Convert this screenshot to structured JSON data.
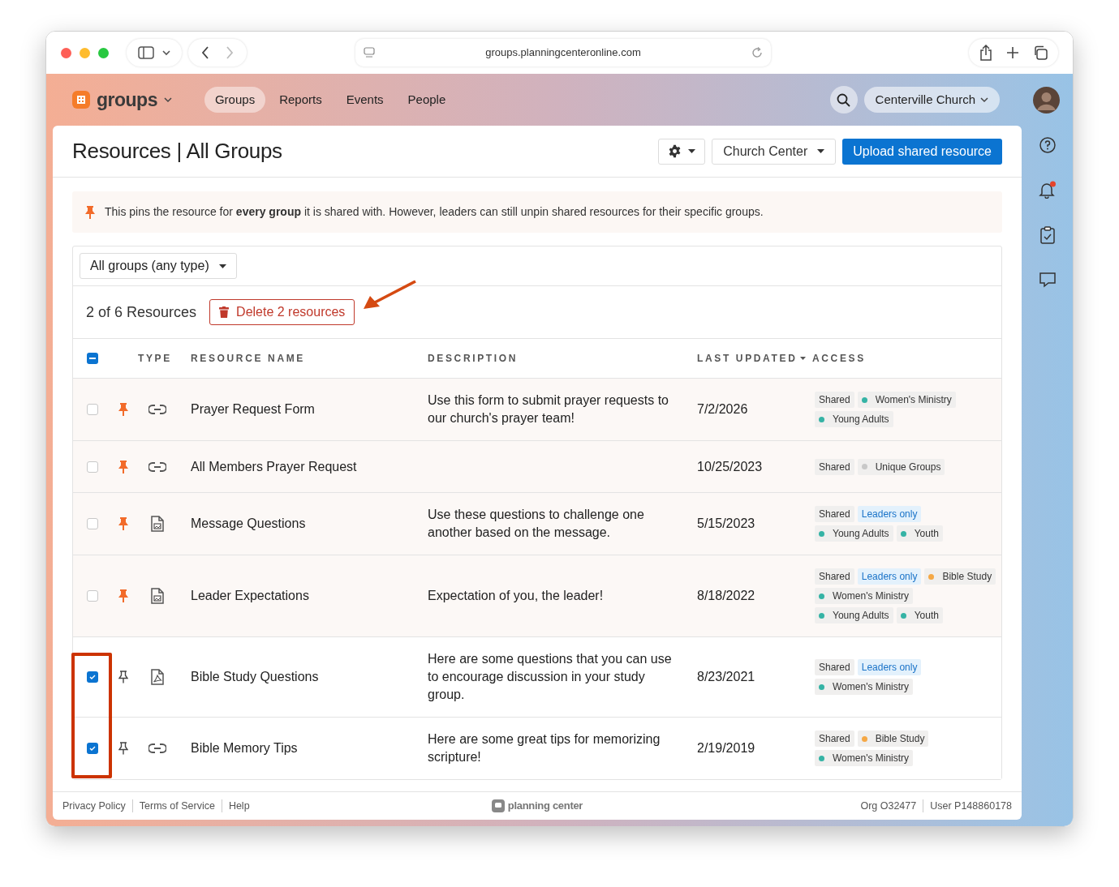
{
  "browser": {
    "url": "groups.planningcenteronline.com"
  },
  "app": {
    "name": "groups",
    "nav": [
      {
        "label": "Groups",
        "selected": true
      },
      {
        "label": "Reports",
        "selected": false
      },
      {
        "label": "Events",
        "selected": false
      },
      {
        "label": "People",
        "selected": false
      }
    ],
    "organization": "Centerville Church"
  },
  "page": {
    "title": "Resources | All Groups",
    "church_center_button": "Church Center",
    "upload_button": "Upload shared resource"
  },
  "notice": "This pins the resource for **every group** it is shared with. However, leaders can still unpin shared resources for their specific groups.",
  "filter": {
    "value": "All groups (any type)"
  },
  "summary": {
    "count": "2 of 6 Resources",
    "delete_button": "Delete 2 resources"
  },
  "table": {
    "select_all_indeterminate": true,
    "columns": [
      {
        "label": "TYPE",
        "sorted": false
      },
      {
        "label": "RESOURCE NAME",
        "sorted": false
      },
      {
        "label": "DESCRIPTION",
        "sorted": false
      },
      {
        "label": "LAST UPDATED",
        "sorted": true
      },
      {
        "label": "ACCESS",
        "sorted": false
      }
    ],
    "rows": [
      {
        "checked": false,
        "pinned": true,
        "kind": "link",
        "name": "Prayer Request Form",
        "description": "Use this form to submit prayer requests to our church's prayer team!",
        "last_updated": "7/2/2026",
        "access": [
          [
            {
              "kind": "shared",
              "label": "Shared"
            },
            {
              "kind": "group",
              "label": "Women's Ministry",
              "color": "#35b3a5"
            }
          ],
          [
            {
              "kind": "group",
              "label": "Young Adults",
              "color": "#35b3a5"
            }
          ]
        ]
      },
      {
        "checked": false,
        "pinned": true,
        "kind": "link",
        "name": "All Members Prayer Request",
        "last_updated": "10/25/2023",
        "access": [
          [
            {
              "kind": "shared",
              "label": "Shared"
            },
            {
              "kind": "group",
              "label": "Unique Groups",
              "color": "#c8c8c8"
            }
          ]
        ]
      },
      {
        "checked": false,
        "pinned": true,
        "kind": "image",
        "name": "Message Questions",
        "description": "Use these questions to challenge one another based on the message.",
        "last_updated": "5/15/2023",
        "access": [
          [
            {
              "kind": "shared",
              "label": "Shared"
            },
            {
              "kind": "leaders",
              "label": "Leaders only"
            }
          ],
          [
            {
              "kind": "group",
              "label": "Young Adults",
              "color": "#35b3a5"
            },
            {
              "kind": "group",
              "label": "Youth",
              "color": "#35b3a5"
            }
          ]
        ]
      },
      {
        "checked": false,
        "pinned": true,
        "kind": "image",
        "name": "Leader Expectations",
        "description": "Expectation of you, the leader!",
        "last_updated": "8/18/2022",
        "access": [
          [
            {
              "kind": "shared",
              "label": "Shared"
            },
            {
              "kind": "leaders",
              "label": "Leaders only"
            },
            {
              "kind": "group",
              "label": "Bible Study",
              "color": "#f5a846"
            }
          ],
          [
            {
              "kind": "group",
              "label": "Women's Ministry",
              "color": "#35b3a5"
            }
          ],
          [
            {
              "kind": "group",
              "label": "Young Adults",
              "color": "#35b3a5"
            },
            {
              "kind": "group",
              "label": "Youth",
              "color": "#35b3a5"
            }
          ]
        ]
      },
      {
        "checked": true,
        "pinned": false,
        "kind": "pdf",
        "name": "Bible Study Questions",
        "description": "Here are some questions that you can use to encourage discussion in your study group.",
        "last_updated": "8/23/2021",
        "access": [
          [
            {
              "kind": "shared",
              "label": "Shared"
            },
            {
              "kind": "leaders",
              "label": "Leaders only"
            }
          ],
          [
            {
              "kind": "group",
              "label": "Women's Ministry",
              "color": "#35b3a5"
            }
          ]
        ]
      },
      {
        "checked": true,
        "pinned": false,
        "kind": "link",
        "name": "Bible Memory Tips",
        "description": "Here are some great tips for memorizing scripture!",
        "last_updated": "2/19/2019",
        "access": [
          [
            {
              "kind": "shared",
              "label": "Shared"
            },
            {
              "kind": "group",
              "label": "Bible Study",
              "color": "#f5a846"
            }
          ],
          [
            {
              "kind": "group",
              "label": "Women's Ministry",
              "color": "#35b3a5"
            }
          ]
        ]
      }
    ]
  },
  "footer": {
    "links": [
      "Privacy Policy",
      "Terms of Service",
      "Help"
    ],
    "brand": "planning center",
    "org": "Org O32477",
    "user": "User P148860178"
  }
}
